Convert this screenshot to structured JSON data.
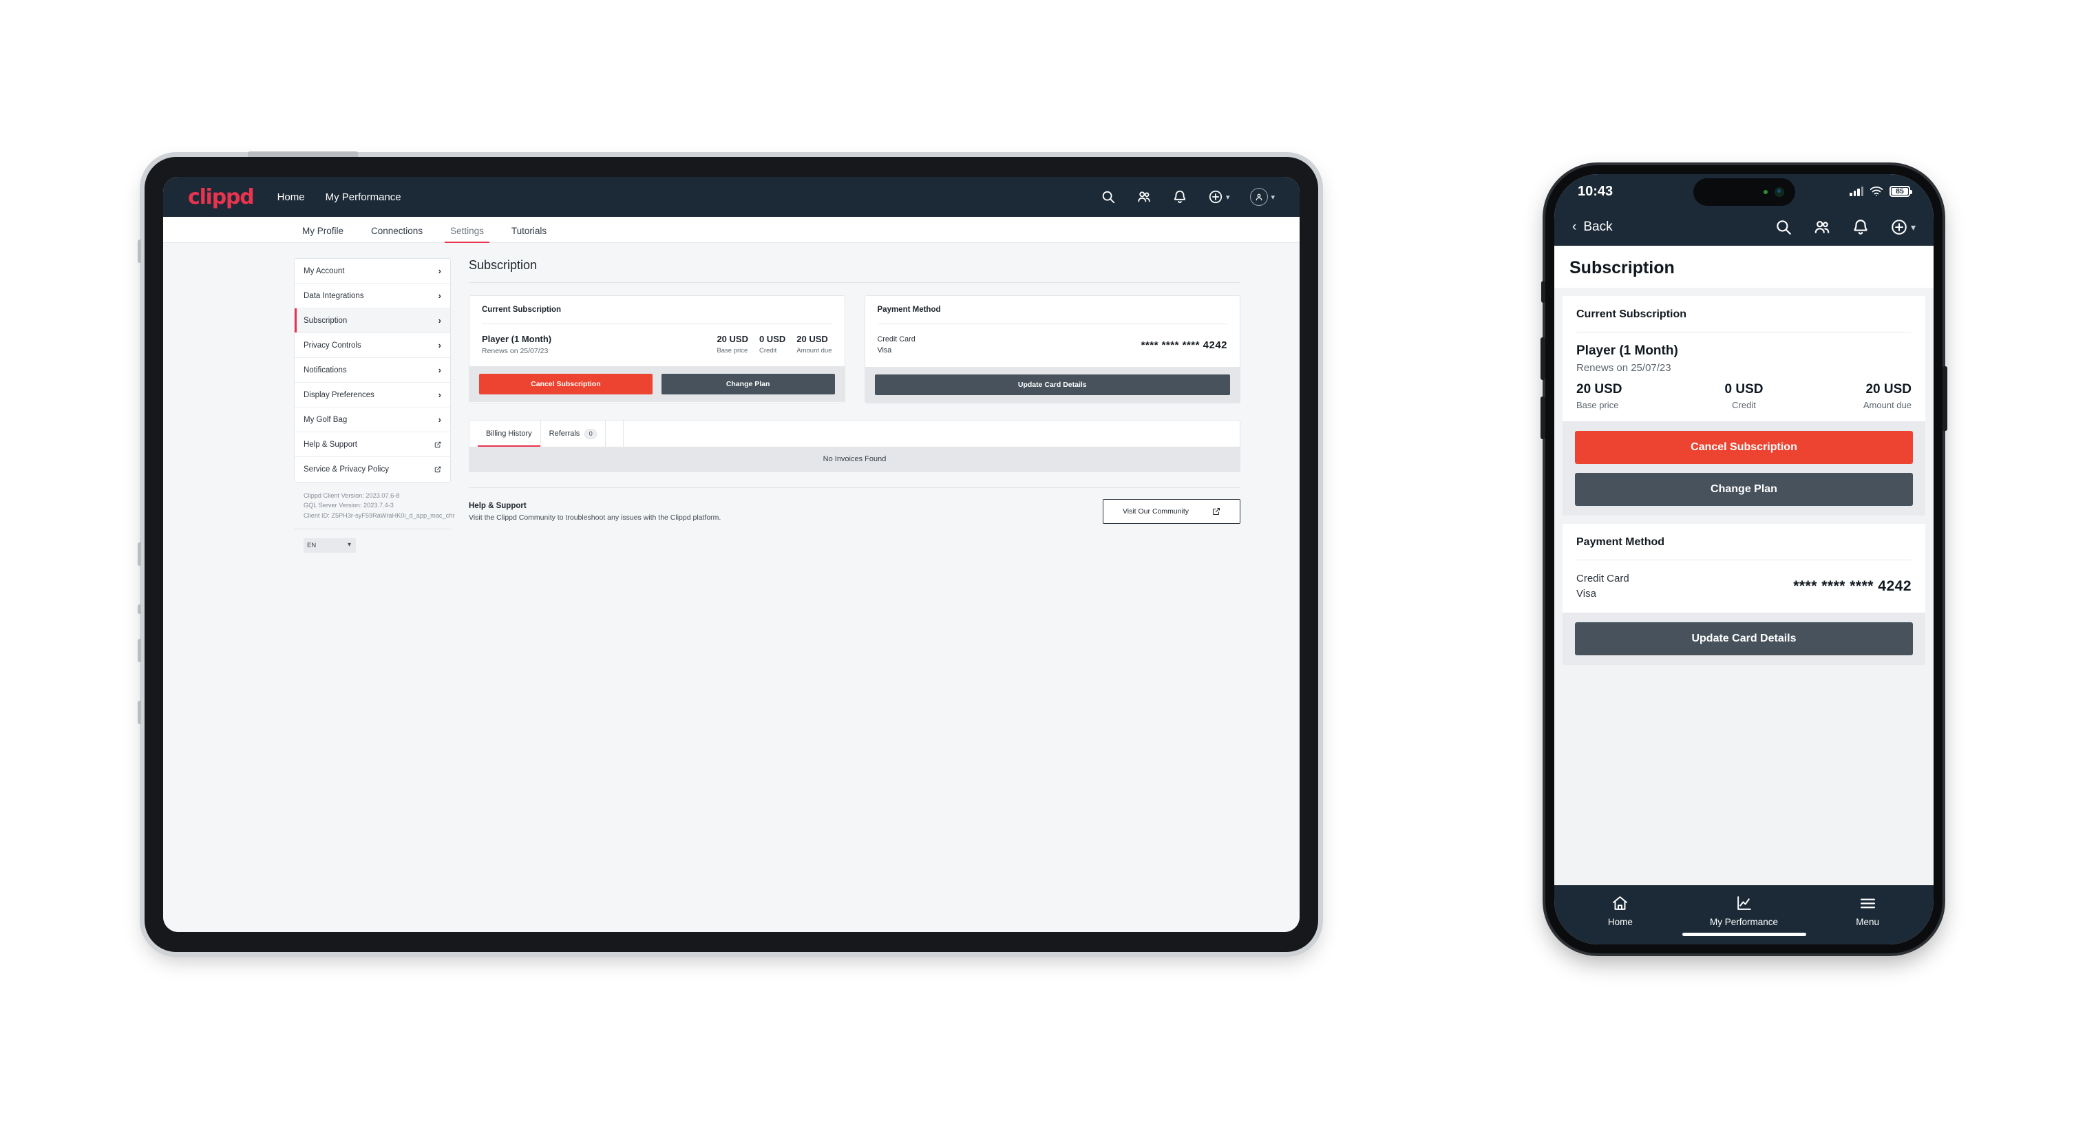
{
  "tablet": {
    "topbar": {
      "logo": "clippd",
      "links": [
        "Home",
        "My Performance"
      ],
      "icons": [
        "search-icon",
        "people-icon",
        "bell-icon",
        "plus-circle-icon",
        "avatar-icon"
      ]
    },
    "tabs": [
      {
        "label": "My Profile",
        "active": false
      },
      {
        "label": "Connections",
        "active": false
      },
      {
        "label": "Settings",
        "active": true
      },
      {
        "label": "Tutorials",
        "active": false
      }
    ],
    "sidebar": {
      "items": [
        {
          "label": "My Account",
          "active": false,
          "external": false
        },
        {
          "label": "Data Integrations",
          "active": false,
          "external": false
        },
        {
          "label": "Subscription",
          "active": true,
          "external": false
        },
        {
          "label": "Privacy Controls",
          "active": false,
          "external": false
        },
        {
          "label": "Notifications",
          "active": false,
          "external": false
        },
        {
          "label": "Display Preferences",
          "active": false,
          "external": false
        },
        {
          "label": "My Golf Bag",
          "active": false,
          "external": false
        },
        {
          "label": "Help & Support",
          "active": false,
          "external": true
        },
        {
          "label": "Service & Privacy Policy",
          "active": false,
          "external": true
        }
      ],
      "versions": [
        "Clippd Client Version: 2023.07.6-8",
        "GQL Server Version: 2023.7.4-3",
        "Client ID: Z5PH3r-syF59RaWraHK0i_d_app_mac_chr"
      ],
      "language": "EN"
    },
    "main": {
      "page_title": "Subscription",
      "current_subscription": {
        "card_title": "Current Subscription",
        "plan_name": "Player (1 Month)",
        "renews": "Renews on 25/07/23",
        "metrics": [
          {
            "value": "20 USD",
            "label": "Base price"
          },
          {
            "value": "0 USD",
            "label": "Credit"
          },
          {
            "value": "20 USD",
            "label": "Amount due"
          }
        ],
        "cancel_label": "Cancel Subscription",
        "change_label": "Change Plan"
      },
      "payment_method": {
        "card_title": "Payment Method",
        "type_line1": "Credit Card",
        "type_line2": "Visa",
        "card_number": "**** **** **** 4242",
        "update_label": "Update Card Details"
      },
      "billing": {
        "tabs": [
          {
            "label": "Billing History",
            "badge": "",
            "active": true
          },
          {
            "label": "Referrals",
            "badge": "0",
            "active": false
          }
        ],
        "empty_text": "No Invoices Found"
      },
      "help": {
        "heading": "Help & Support",
        "body": "Visit the Clippd Community to troubleshoot any issues with the Clippd platform.",
        "button_label": "Visit Our Community"
      }
    }
  },
  "phone": {
    "status": {
      "time": "10:43",
      "battery": "85"
    },
    "nav": {
      "back_label": "Back",
      "icons": [
        "search-icon",
        "people-icon",
        "bell-icon",
        "plus-circle-icon"
      ]
    },
    "page_title": "Subscription",
    "current_subscription": {
      "card_title": "Current Subscription",
      "plan_name": "Player (1 Month)",
      "renews": "Renews on 25/07/23",
      "metrics": [
        {
          "value": "20 USD",
          "label": "Base price"
        },
        {
          "value": "0 USD",
          "label": "Credit"
        },
        {
          "value": "20 USD",
          "label": "Amount due"
        }
      ],
      "cancel_label": "Cancel Subscription",
      "change_label": "Change Plan"
    },
    "payment_method": {
      "card_title": "Payment Method",
      "type_line1": "Credit Card",
      "type_line2": "Visa",
      "card_number": "**** **** **** 4242",
      "update_label": "Update Card Details"
    },
    "tabbar": [
      {
        "label": "Home",
        "icon": "home-icon"
      },
      {
        "label": "My Performance",
        "icon": "chart-icon"
      },
      {
        "label": "Menu",
        "icon": "hamburger-icon"
      }
    ]
  },
  "colors": {
    "nav_dark": "#1c2a37",
    "brand_red": "#e8344e",
    "danger": "#ec4430",
    "dark_button": "#47525c"
  }
}
